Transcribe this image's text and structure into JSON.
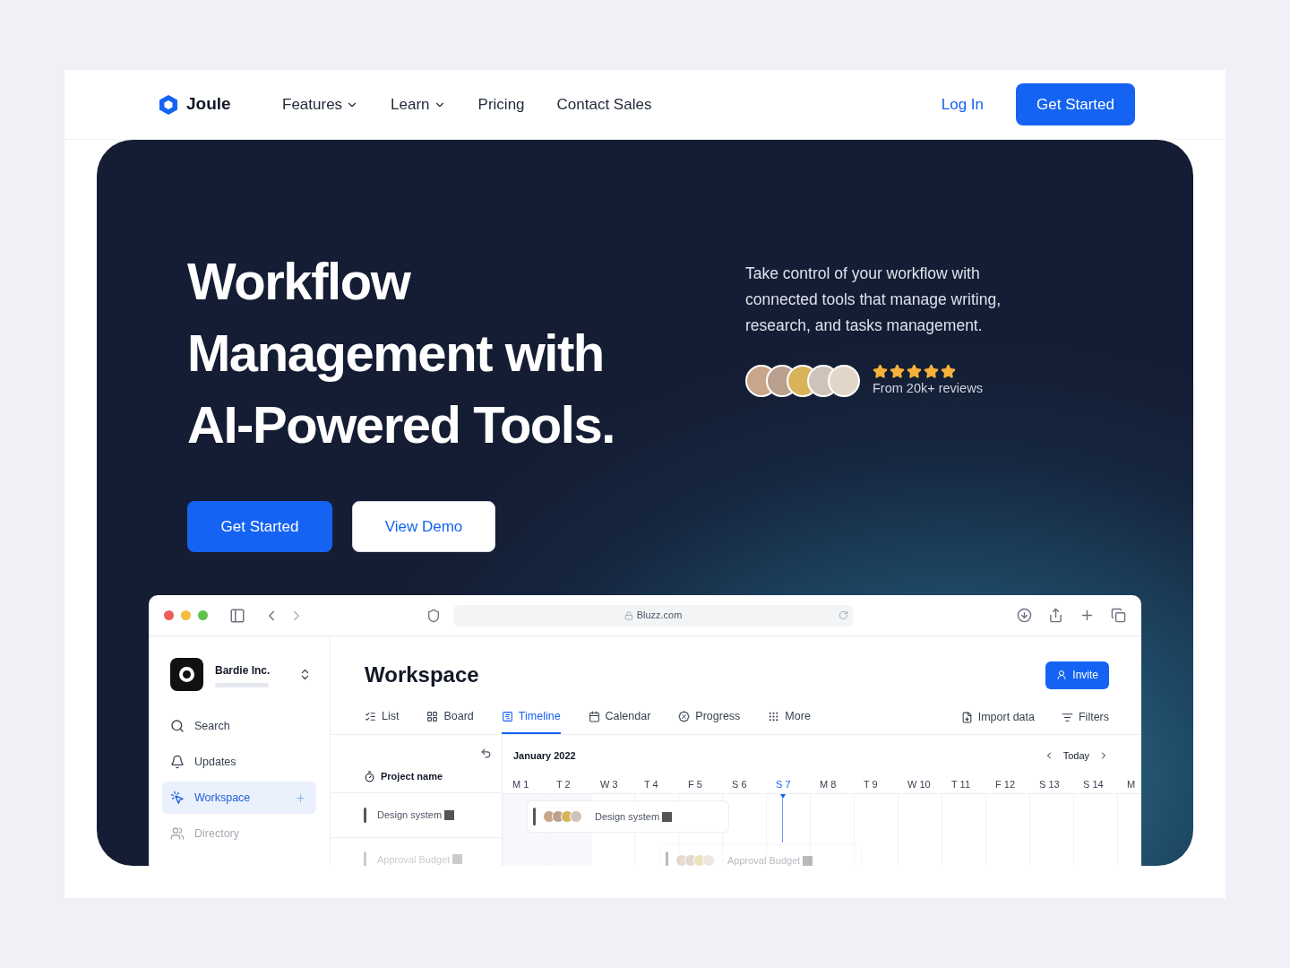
{
  "nav": {
    "brand": "Joule",
    "links": [
      {
        "label": "Features",
        "dropdown": true
      },
      {
        "label": "Learn",
        "dropdown": true
      },
      {
        "label": "Pricing",
        "dropdown": false
      },
      {
        "label": "Contact Sales",
        "dropdown": false
      }
    ],
    "login": "Log In",
    "cta": "Get Started"
  },
  "hero": {
    "headline": [
      "Workflow",
      "Management with",
      "AI-Powered Tools."
    ],
    "description": "Take control of your workflow with connected tools that manage writing, research, and tasks management.",
    "stars": 5,
    "reviews": "From 20k+ reviews",
    "primary": "Get Started",
    "secondary": "View Demo"
  },
  "browser": {
    "url": "Bluzz.com"
  },
  "app": {
    "org": "Bardie Inc.",
    "sidebar": [
      {
        "label": "Search",
        "selected": false,
        "faded": false
      },
      {
        "label": "Updates",
        "selected": false,
        "faded": false
      },
      {
        "label": "Workspace",
        "selected": true,
        "faded": false
      },
      {
        "label": "Directory",
        "selected": false,
        "faded": true
      }
    ],
    "title": "Workspace",
    "invite": "Invite",
    "tabs": [
      {
        "label": "List",
        "selected": false
      },
      {
        "label": "Board",
        "selected": false
      },
      {
        "label": "Timeline",
        "selected": true
      },
      {
        "label": "Calendar",
        "selected": false
      },
      {
        "label": "Progress",
        "selected": false
      },
      {
        "label": "More",
        "selected": false
      }
    ],
    "actions": [
      "Import data",
      "Filters"
    ],
    "month": "January 2022",
    "today": "Today",
    "column_header": "Project name",
    "days": [
      {
        "label": "M 1",
        "selected": false
      },
      {
        "label": "T 2",
        "selected": false
      },
      {
        "label": "W 3",
        "selected": false
      },
      {
        "label": "T 4",
        "selected": false
      },
      {
        "label": "F 5",
        "selected": false
      },
      {
        "label": "S 6",
        "selected": false
      },
      {
        "label": "S 7",
        "selected": true
      },
      {
        "label": "M 8",
        "selected": false
      },
      {
        "label": "T 9",
        "selected": false
      },
      {
        "label": "W 10",
        "selected": false
      },
      {
        "label": "T 11",
        "selected": false
      },
      {
        "label": "F 12",
        "selected": false
      },
      {
        "label": "S 13",
        "selected": false
      },
      {
        "label": "S 14",
        "selected": false
      },
      {
        "label": "M",
        "selected": false
      }
    ],
    "rows": [
      {
        "name": "Design system",
        "bar": "Design system",
        "faded": false
      },
      {
        "name": "Approval Budget",
        "bar": "Approval Budget",
        "faded": true
      }
    ]
  }
}
